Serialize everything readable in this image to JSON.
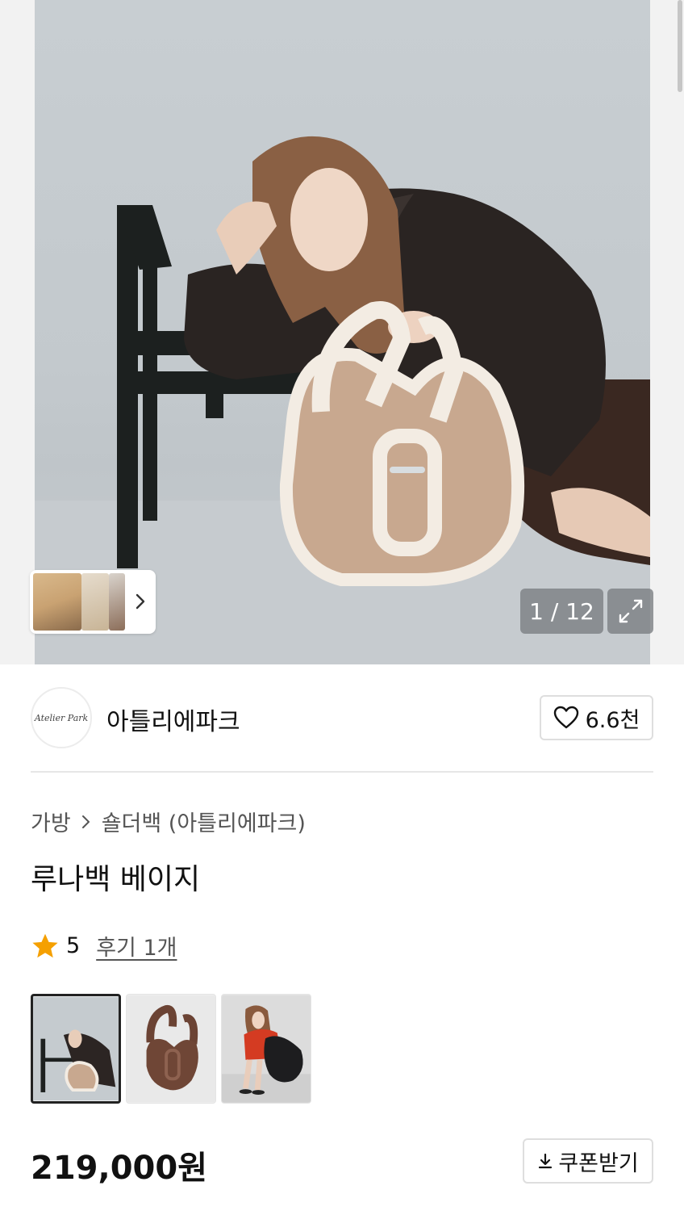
{
  "gallery": {
    "current_index": "1",
    "total": "12",
    "counter_text": "1 / 12",
    "icons": {
      "next": "chevron-right-icon",
      "expand": "expand-icon"
    }
  },
  "brand": {
    "logo_text": "Atelier Park",
    "name": "아틀리에파크",
    "likes_label": "6.6천",
    "like_icon": "heart-outline-icon"
  },
  "breadcrumb": {
    "items": [
      "가방",
      "숄더백 (아틀리에파크)"
    ]
  },
  "product": {
    "title": "루나백 베이지",
    "rating": "5",
    "reviews_label": "후기 1개",
    "star_color": "#f5a000",
    "price": "219,000원"
  },
  "options": [
    {
      "name": "beige",
      "selected": true
    },
    {
      "name": "brown",
      "selected": false
    },
    {
      "name": "black",
      "selected": false
    }
  ],
  "coupon": {
    "label": "쿠폰받기",
    "icon": "download-icon"
  }
}
